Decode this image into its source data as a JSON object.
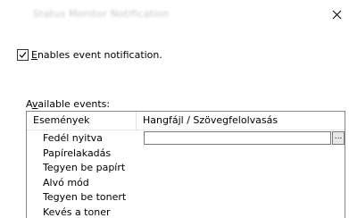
{
  "window": {
    "title": "Status Monitor Notification"
  },
  "notification": {
    "checked": true,
    "label_access_key": "E",
    "label_rest": "nables event notification."
  },
  "events_group": {
    "label_prefix": "A",
    "label_access_key": "v",
    "label_rest": "ailable events:"
  },
  "table": {
    "columns": [
      "Események",
      "Hangfájl / Szövegfelolvasás"
    ],
    "rows": [
      {
        "event": "Fedél nyitva",
        "file": ""
      },
      {
        "event": "Papírelakadás"
      },
      {
        "event": "Tegyen be papírt"
      },
      {
        "event": "Alvó mód"
      },
      {
        "event": "Tegyen be tonert"
      },
      {
        "event": "Kevés a toner"
      }
    ],
    "browse_label": "..."
  },
  "icons": {
    "close": "close-icon",
    "check": "checkmark-icon"
  }
}
